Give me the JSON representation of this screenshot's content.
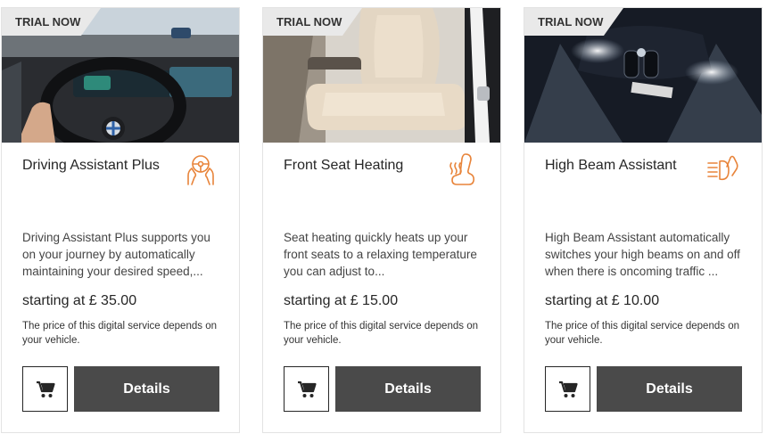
{
  "colors": {
    "accent": "#e8843a",
    "button_dark": "#4a4a4a",
    "badge_bg": "#e9e9e9",
    "border": "#e3e3e3"
  },
  "cards": [
    {
      "badge": "TRIAL NOW",
      "title": "Driving Assistant Plus",
      "icon": "steering-hands-icon",
      "description": "Driving Assistant Plus supports you on your journey by automatically maintaining your desired speed,...",
      "price": "starting at £ 35.00",
      "note": "The price of this digital service depends on your vehicle.",
      "cart_icon": "shopping-cart-icon",
      "details_label": "Details"
    },
    {
      "badge": "TRIAL NOW",
      "title": "Front Seat Heating",
      "icon": "seat-heating-icon",
      "description": "Seat heating quickly heats up your front seats to a relaxing temperature you can adjust to...",
      "price": "starting at £ 15.00",
      "note": "The price of this digital service depends on your vehicle.",
      "cart_icon": "shopping-cart-icon",
      "details_label": "Details"
    },
    {
      "badge": "TRIAL NOW",
      "title": "High Beam Assistant",
      "icon": "high-beam-icon",
      "description": "High Beam Assistant automatically switches your high beams on and off when there is oncoming traffic ...",
      "price": "starting at £ 10.00",
      "note": "The price of this digital service depends on your vehicle.",
      "cart_icon": "shopping-cart-icon",
      "details_label": "Details"
    }
  ]
}
